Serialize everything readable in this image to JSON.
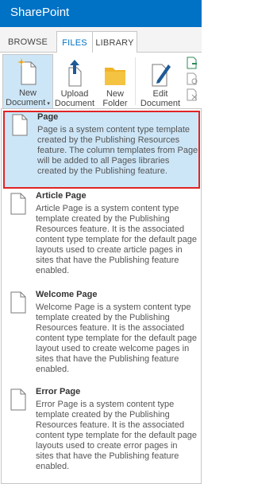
{
  "suite": {
    "title": "SharePoint"
  },
  "tabs": [
    {
      "label": "BROWSE"
    },
    {
      "label": "FILES"
    },
    {
      "label": "LIBRARY"
    }
  ],
  "ribbon": {
    "new_document": {
      "line1": "New",
      "line2": "Document"
    },
    "upload_document": {
      "line1": "Upload",
      "line2": "Document"
    },
    "new_folder": {
      "line1": "New",
      "line2": "Folder"
    },
    "edit_document": {
      "line1": "Edit",
      "line2": "Document"
    }
  },
  "menu": {
    "items": [
      {
        "name": "Page",
        "description": "Page is a system content type template created by the Publishing Resources feature. The column templates from Page will be added to all Pages libraries created by the Publishing feature."
      },
      {
        "name": "Article Page",
        "description": "Article Page is a system content type template created by the Publishing Resources feature. It is the associated content type template for the default page layouts used to create article pages in sites that have the Publishing feature enabled."
      },
      {
        "name": "Welcome Page",
        "description": "Welcome Page is a system content type template created by the Publishing Resources feature. It is the associated content type template for the default page layout used to create welcome pages in sites that have the Publishing feature enabled."
      },
      {
        "name": "Error Page",
        "description": "Error Page is a system content type template created by the Publishing Resources feature. It is the associated content type template for the default page layouts used to create error pages in sites that have the Publishing feature enabled."
      }
    ]
  },
  "colors": {
    "suite_bar": "#0072c6",
    "selected_bg": "#cde6f7",
    "highlight_border": "#e02424"
  }
}
